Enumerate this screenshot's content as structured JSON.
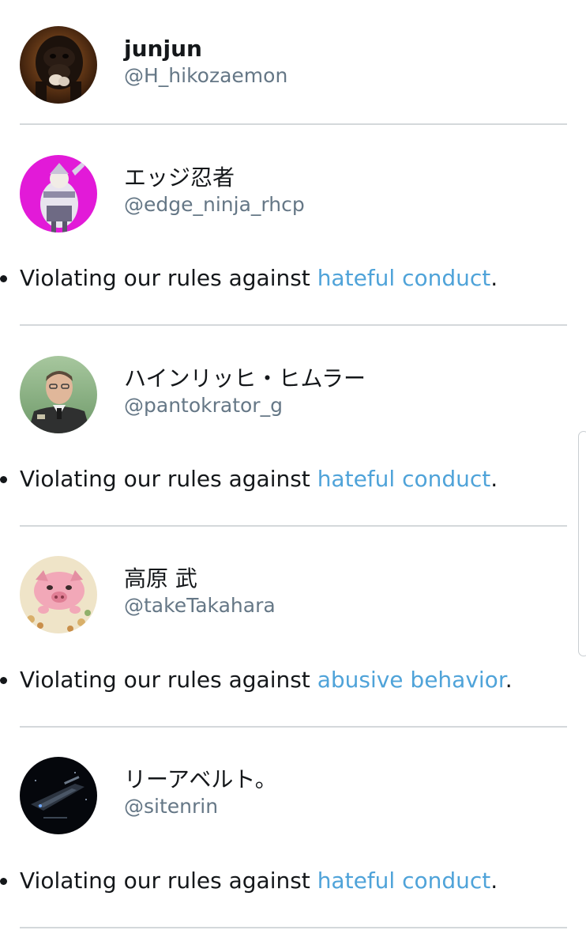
{
  "accounts": [
    {
      "name": "junjun",
      "handle": "@H_hikozaemon",
      "avatar_icon": "gorilla-avatar"
    },
    {
      "name": "エッジ忍者",
      "handle": "@edge_ninja_rhcp",
      "avatar_icon": "anime-character-avatar",
      "reason_prefix": "Violating our rules against ",
      "reason_link": "hateful conduct",
      "reason_suffix": "."
    },
    {
      "name": "ハインリッヒ・ヒムラー",
      "handle": "@pantokrator_g",
      "avatar_icon": "uniformed-man-avatar",
      "reason_prefix": "Violating our rules against ",
      "reason_link": "hateful conduct",
      "reason_suffix": "."
    },
    {
      "name": "高原 武",
      "handle": "@takeTakahara",
      "avatar_icon": "pink-pig-avatar",
      "reason_prefix": "Violating our rules against ",
      "reason_link": "abusive behavior",
      "reason_suffix": "."
    },
    {
      "name": "リーアベルト。",
      "handle": "@sitenrin",
      "avatar_icon": "spaceship-avatar",
      "reason_prefix": "Violating our rules against ",
      "reason_link": "hateful conduct",
      "reason_suffix": "."
    }
  ],
  "colors": {
    "link": "#4fa3d9",
    "handle": "#657786",
    "text": "#14171a",
    "divider": "#d4d8db"
  }
}
